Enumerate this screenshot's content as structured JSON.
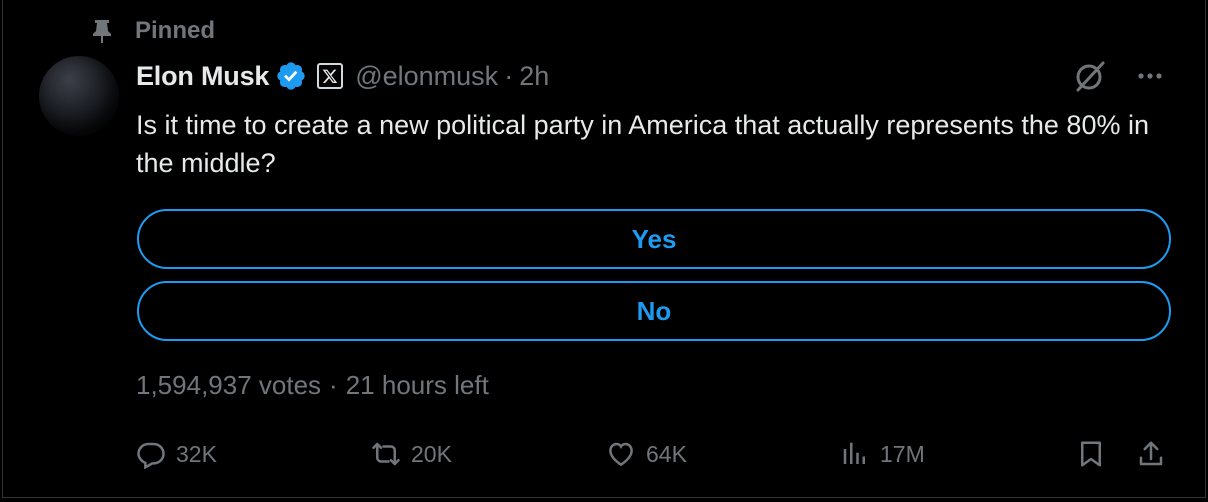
{
  "pinned": {
    "label": "Pinned"
  },
  "author": {
    "name": "Elon Musk",
    "handle": "@elonmusk",
    "separator": "·",
    "time": "2h",
    "affiliate_badge": "𝕏"
  },
  "tweet": {
    "text": "Is it time to create a new political party in America that actually represents the 80% in the middle?"
  },
  "poll": {
    "options": [
      "Yes",
      "No"
    ],
    "votes": "1,594,937 votes",
    "separator": "·",
    "time_left": "21 hours left"
  },
  "actions": {
    "replies": "32K",
    "retweets": "20K",
    "likes": "64K",
    "views": "17M"
  },
  "colors": {
    "accent": "#1d9bf0",
    "muted": "#71767b",
    "text": "#e7e9ea",
    "background": "#000000"
  },
  "icons": [
    "pin-icon",
    "verified-badge-icon",
    "x-logo-icon",
    "grok-icon",
    "more-icon",
    "reply-icon",
    "retweet-icon",
    "like-icon",
    "views-icon",
    "bookmark-icon",
    "share-icon"
  ]
}
